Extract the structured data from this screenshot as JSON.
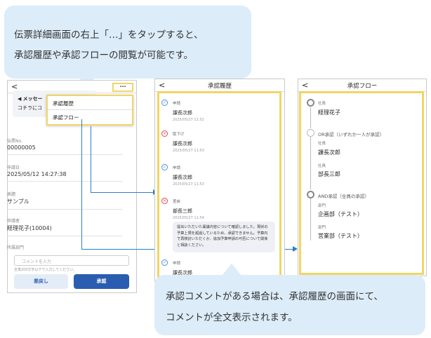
{
  "callout_top": {
    "line1": "伝票詳細画面の右上「…」をタップすると、",
    "line2": "承認履歴や承認フローの閲覧が可能です。"
  },
  "callout_bottom": {
    "line1": "承認コメントがある場合は、承認履歴の画面にて、",
    "line2": "コメントが全文表示されます。"
  },
  "detail_screen": {
    "back": "<",
    "more": "···",
    "message_title": "メッセー",
    "message_body": "コチラにコ",
    "fields": [
      {
        "label": "伝票No.",
        "value": "00000005"
      },
      {
        "label": "申請日",
        "value": "2025/05/12 14:27:38"
      },
      {
        "label": "表題",
        "value": "サンプル"
      },
      {
        "label": "申請者",
        "value": "経理花子(10004)"
      },
      {
        "label": "所属部門",
        "value": ""
      }
    ],
    "menu": [
      "承認履歴",
      "承認フロー"
    ],
    "comment_placeholder": "コメントを入力",
    "comment_note": "全角200文字以下で入力してください。",
    "return_button": "差戻し",
    "approve_button": "承認"
  },
  "history_screen": {
    "back": "<",
    "title": "承認履歴",
    "items": [
      {
        "status": "申請",
        "name": "課長次郎",
        "date": "2025/05/27 11:52",
        "icon": "check"
      },
      {
        "status": "取下げ",
        "name": "課長次郎",
        "date": "2025/05/27 11:53",
        "icon": "cross"
      },
      {
        "status": "申請",
        "name": "課長次郎",
        "date": "2025/05/27 11:53",
        "icon": "check"
      },
      {
        "status": "差戻",
        "name": "部長三郎",
        "date": "2025/05/27 11:54",
        "icon": "cross"
      },
      {
        "status": "申請",
        "name": "課長次郎",
        "date": "",
        "icon": "check"
      }
    ],
    "comment": "提出いただいた稟議内容について確認しました。現状の予算上限を超過しているため、承認できません。予算内で再検討いただくか、追加予算申請の可否について関係と相談ください。"
  },
  "flow_screen": {
    "back": "<",
    "title": "承認フロー",
    "nodes": [
      {
        "header": "",
        "role": "社員",
        "name": "経理花子"
      },
      {
        "header": "OR承認（いずれか一人が承認）",
        "role": "社員",
        "name": "課長次郎"
      },
      {
        "header": "",
        "role": "社員",
        "name": "部長三郎"
      },
      {
        "header": "AND承認（全員の承認）",
        "role": "部門",
        "name": "企画部（テスト）"
      },
      {
        "header": "",
        "role": "部門",
        "name": "営業部（テスト）"
      }
    ]
  },
  "colors": {
    "bubble": "#dcecf9",
    "highlight": "#f1d565",
    "accent": "#2a5db0",
    "connector": "#2a7fc9"
  }
}
